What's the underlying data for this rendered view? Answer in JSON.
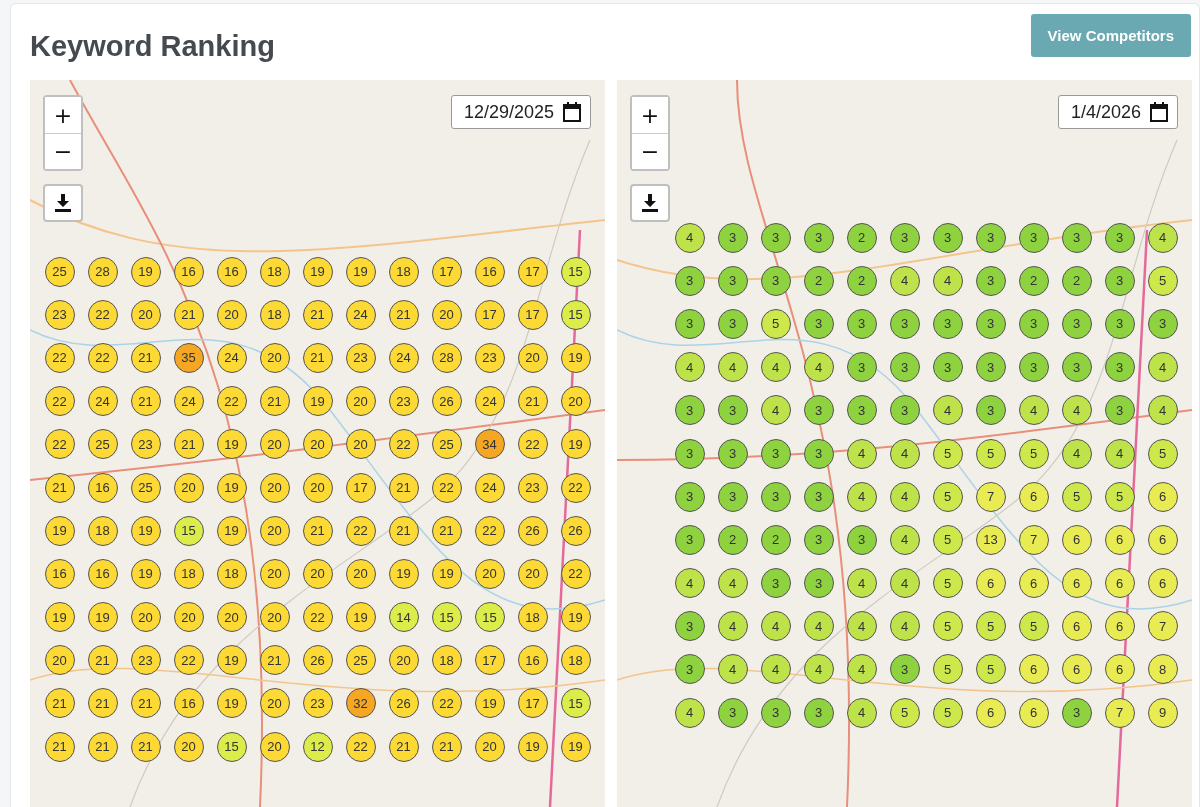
{
  "title": "Keyword Ranking",
  "action_button": "View Competitors",
  "maps": [
    {
      "zoom_in": "+",
      "zoom_out": "−",
      "date": "12/29/2025",
      "grid": [
        [
          {
            "rank": "25",
            "color": "#fcd934"
          },
          {
            "rank": "28",
            "color": "#fcd934"
          },
          {
            "rank": "19",
            "color": "#fcd934"
          },
          {
            "rank": "16",
            "color": "#fcd934"
          },
          {
            "rank": "16",
            "color": "#fcd934"
          },
          {
            "rank": "18",
            "color": "#fcd934"
          },
          {
            "rank": "19",
            "color": "#fcd934"
          },
          {
            "rank": "19",
            "color": "#fcd934"
          },
          {
            "rank": "18",
            "color": "#fcd934"
          },
          {
            "rank": "17",
            "color": "#fcd934"
          },
          {
            "rank": "16",
            "color": "#fcd934"
          },
          {
            "rank": "17",
            "color": "#fcd934"
          },
          {
            "rank": "15",
            "color": "#dcec4a"
          }
        ],
        [
          {
            "rank": "23",
            "color": "#fcd934"
          },
          {
            "rank": "22",
            "color": "#fcd934"
          },
          {
            "rank": "20",
            "color": "#fcd934"
          },
          {
            "rank": "21",
            "color": "#fcd934"
          },
          {
            "rank": "20",
            "color": "#fcd934"
          },
          {
            "rank": "18",
            "color": "#fcd934"
          },
          {
            "rank": "21",
            "color": "#fcd934"
          },
          {
            "rank": "24",
            "color": "#fcd934"
          },
          {
            "rank": "21",
            "color": "#fcd934"
          },
          {
            "rank": "20",
            "color": "#fcd934"
          },
          {
            "rank": "17",
            "color": "#fcd934"
          },
          {
            "rank": "17",
            "color": "#fcd934"
          },
          {
            "rank": "15",
            "color": "#dcec4a"
          }
        ],
        [
          {
            "rank": "22",
            "color": "#fcd934"
          },
          {
            "rank": "22",
            "color": "#fcd934"
          },
          {
            "rank": "21",
            "color": "#fcd934"
          },
          {
            "rank": "35",
            "color": "#f5a623"
          },
          {
            "rank": "24",
            "color": "#fcd934"
          },
          {
            "rank": "20",
            "color": "#fcd934"
          },
          {
            "rank": "21",
            "color": "#fcd934"
          },
          {
            "rank": "23",
            "color": "#fcd934"
          },
          {
            "rank": "24",
            "color": "#fcd934"
          },
          {
            "rank": "28",
            "color": "#fcd934"
          },
          {
            "rank": "23",
            "color": "#fcd934"
          },
          {
            "rank": "20",
            "color": "#fcd934"
          },
          {
            "rank": "19",
            "color": "#fcd934"
          }
        ],
        [
          {
            "rank": "22",
            "color": "#fcd934"
          },
          {
            "rank": "24",
            "color": "#fcd934"
          },
          {
            "rank": "21",
            "color": "#fcd934"
          },
          {
            "rank": "24",
            "color": "#fcd934"
          },
          {
            "rank": "22",
            "color": "#fcd934"
          },
          {
            "rank": "21",
            "color": "#fcd934"
          },
          {
            "rank": "19",
            "color": "#fcd934"
          },
          {
            "rank": "20",
            "color": "#fcd934"
          },
          {
            "rank": "23",
            "color": "#fcd934"
          },
          {
            "rank": "26",
            "color": "#fcd934"
          },
          {
            "rank": "24",
            "color": "#fcd934"
          },
          {
            "rank": "21",
            "color": "#fcd934"
          },
          {
            "rank": "20",
            "color": "#fcd934"
          }
        ],
        [
          {
            "rank": "22",
            "color": "#fcd934"
          },
          {
            "rank": "25",
            "color": "#fcd934"
          },
          {
            "rank": "23",
            "color": "#fcd934"
          },
          {
            "rank": "21",
            "color": "#fcd934"
          },
          {
            "rank": "19",
            "color": "#fcd934"
          },
          {
            "rank": "20",
            "color": "#fcd934"
          },
          {
            "rank": "20",
            "color": "#fcd934"
          },
          {
            "rank": "20",
            "color": "#fcd934"
          },
          {
            "rank": "22",
            "color": "#fcd934"
          },
          {
            "rank": "25",
            "color": "#fcd934"
          },
          {
            "rank": "34",
            "color": "#f5a623"
          },
          {
            "rank": "22",
            "color": "#fcd934"
          },
          {
            "rank": "19",
            "color": "#fcd934"
          }
        ],
        [
          {
            "rank": "21",
            "color": "#fcd934"
          },
          {
            "rank": "16",
            "color": "#fcd934"
          },
          {
            "rank": "25",
            "color": "#fcd934"
          },
          {
            "rank": "20",
            "color": "#fcd934"
          },
          {
            "rank": "19",
            "color": "#fcd934"
          },
          {
            "rank": "20",
            "color": "#fcd934"
          },
          {
            "rank": "20",
            "color": "#fcd934"
          },
          {
            "rank": "17",
            "color": "#fcd934"
          },
          {
            "rank": "21",
            "color": "#fcd934"
          },
          {
            "rank": "22",
            "color": "#fcd934"
          },
          {
            "rank": "24",
            "color": "#fcd934"
          },
          {
            "rank": "23",
            "color": "#fcd934"
          },
          {
            "rank": "22",
            "color": "#fcd934"
          }
        ],
        [
          {
            "rank": "19",
            "color": "#fcd934"
          },
          {
            "rank": "18",
            "color": "#fcd934"
          },
          {
            "rank": "19",
            "color": "#fcd934"
          },
          {
            "rank": "15",
            "color": "#dcec4a"
          },
          {
            "rank": "19",
            "color": "#fcd934"
          },
          {
            "rank": "20",
            "color": "#fcd934"
          },
          {
            "rank": "21",
            "color": "#fcd934"
          },
          {
            "rank": "22",
            "color": "#fcd934"
          },
          {
            "rank": "21",
            "color": "#fcd934"
          },
          {
            "rank": "21",
            "color": "#fcd934"
          },
          {
            "rank": "22",
            "color": "#fcd934"
          },
          {
            "rank": "26",
            "color": "#fcd934"
          },
          {
            "rank": "26",
            "color": "#fcd934"
          }
        ],
        [
          {
            "rank": "16",
            "color": "#fcd934"
          },
          {
            "rank": "16",
            "color": "#fcd934"
          },
          {
            "rank": "19",
            "color": "#fcd934"
          },
          {
            "rank": "18",
            "color": "#fcd934"
          },
          {
            "rank": "18",
            "color": "#fcd934"
          },
          {
            "rank": "20",
            "color": "#fcd934"
          },
          {
            "rank": "20",
            "color": "#fcd934"
          },
          {
            "rank": "20",
            "color": "#fcd934"
          },
          {
            "rank": "19",
            "color": "#fcd934"
          },
          {
            "rank": "19",
            "color": "#fcd934"
          },
          {
            "rank": "20",
            "color": "#fcd934"
          },
          {
            "rank": "20",
            "color": "#fcd934"
          },
          {
            "rank": "22",
            "color": "#fcd934"
          }
        ],
        [
          {
            "rank": "19",
            "color": "#fcd934"
          },
          {
            "rank": "19",
            "color": "#fcd934"
          },
          {
            "rank": "20",
            "color": "#fcd934"
          },
          {
            "rank": "20",
            "color": "#fcd934"
          },
          {
            "rank": "20",
            "color": "#fcd934"
          },
          {
            "rank": "20",
            "color": "#fcd934"
          },
          {
            "rank": "22",
            "color": "#fcd934"
          },
          {
            "rank": "19",
            "color": "#fcd934"
          },
          {
            "rank": "14",
            "color": "#dcec4a"
          },
          {
            "rank": "15",
            "color": "#dcec4a"
          },
          {
            "rank": "15",
            "color": "#dcec4a"
          },
          {
            "rank": "18",
            "color": "#fcd934"
          },
          {
            "rank": "19",
            "color": "#fcd934"
          }
        ],
        [
          {
            "rank": "20",
            "color": "#fcd934"
          },
          {
            "rank": "21",
            "color": "#fcd934"
          },
          {
            "rank": "23",
            "color": "#fcd934"
          },
          {
            "rank": "22",
            "color": "#fcd934"
          },
          {
            "rank": "19",
            "color": "#fcd934"
          },
          {
            "rank": "21",
            "color": "#fcd934"
          },
          {
            "rank": "26",
            "color": "#fcd934"
          },
          {
            "rank": "25",
            "color": "#fcd934"
          },
          {
            "rank": "20",
            "color": "#fcd934"
          },
          {
            "rank": "18",
            "color": "#fcd934"
          },
          {
            "rank": "17",
            "color": "#fcd934"
          },
          {
            "rank": "16",
            "color": "#fcd934"
          },
          {
            "rank": "18",
            "color": "#fcd934"
          }
        ],
        [
          {
            "rank": "21",
            "color": "#fcd934"
          },
          {
            "rank": "21",
            "color": "#fcd934"
          },
          {
            "rank": "21",
            "color": "#fcd934"
          },
          {
            "rank": "16",
            "color": "#fcd934"
          },
          {
            "rank": "19",
            "color": "#fcd934"
          },
          {
            "rank": "20",
            "color": "#fcd934"
          },
          {
            "rank": "23",
            "color": "#fcd934"
          },
          {
            "rank": "32",
            "color": "#f5a623"
          },
          {
            "rank": "26",
            "color": "#fcd934"
          },
          {
            "rank": "22",
            "color": "#fcd934"
          },
          {
            "rank": "19",
            "color": "#fcd934"
          },
          {
            "rank": "17",
            "color": "#fcd934"
          },
          {
            "rank": "15",
            "color": "#dcec4a"
          }
        ],
        [
          {
            "rank": "21",
            "color": "#fcd934"
          },
          {
            "rank": "21",
            "color": "#fcd934"
          },
          {
            "rank": "21",
            "color": "#fcd934"
          },
          {
            "rank": "20",
            "color": "#fcd934"
          },
          {
            "rank": "15",
            "color": "#dcec4a"
          },
          {
            "rank": "20",
            "color": "#fcd934"
          },
          {
            "rank": "12",
            "color": "#dcec4a"
          },
          {
            "rank": "22",
            "color": "#fcd934"
          },
          {
            "rank": "21",
            "color": "#fcd934"
          },
          {
            "rank": "21",
            "color": "#fcd934"
          },
          {
            "rank": "20",
            "color": "#fcd934"
          },
          {
            "rank": "19",
            "color": "#fcd934"
          },
          {
            "rank": "19",
            "color": "#fcd934"
          }
        ]
      ]
    },
    {
      "zoom_in": "+",
      "zoom_out": "−",
      "date": "1/4/2026",
      "grid": [
        [
          {
            "rank": "4",
            "color": "#bde24a"
          },
          {
            "rank": "3",
            "color": "#8fd23f"
          },
          {
            "rank": "3",
            "color": "#8fd23f"
          },
          {
            "rank": "3",
            "color": "#8fd23f"
          },
          {
            "rank": "2",
            "color": "#8fd23f"
          },
          {
            "rank": "3",
            "color": "#8fd23f"
          },
          {
            "rank": "3",
            "color": "#8fd23f"
          },
          {
            "rank": "3",
            "color": "#8fd23f"
          },
          {
            "rank": "3",
            "color": "#8fd23f"
          },
          {
            "rank": "3",
            "color": "#8fd23f"
          },
          {
            "rank": "3",
            "color": "#8fd23f"
          },
          {
            "rank": "4",
            "color": "#bde24a"
          }
        ],
        [
          {
            "rank": "3",
            "color": "#8fd23f"
          },
          {
            "rank": "3",
            "color": "#8fd23f"
          },
          {
            "rank": "3",
            "color": "#8fd23f"
          },
          {
            "rank": "2",
            "color": "#8fd23f"
          },
          {
            "rank": "2",
            "color": "#8fd23f"
          },
          {
            "rank": "4",
            "color": "#bde24a"
          },
          {
            "rank": "4",
            "color": "#bde24a"
          },
          {
            "rank": "3",
            "color": "#8fd23f"
          },
          {
            "rank": "2",
            "color": "#8fd23f"
          },
          {
            "rank": "2",
            "color": "#8fd23f"
          },
          {
            "rank": "3",
            "color": "#8fd23f"
          },
          {
            "rank": "5",
            "color": "#cde84a"
          }
        ],
        [
          {
            "rank": "3",
            "color": "#8fd23f"
          },
          {
            "rank": "3",
            "color": "#8fd23f"
          },
          {
            "rank": "5",
            "color": "#cde84a"
          },
          {
            "rank": "3",
            "color": "#8fd23f"
          },
          {
            "rank": "3",
            "color": "#8fd23f"
          },
          {
            "rank": "3",
            "color": "#8fd23f"
          },
          {
            "rank": "3",
            "color": "#8fd23f"
          },
          {
            "rank": "3",
            "color": "#8fd23f"
          },
          {
            "rank": "3",
            "color": "#8fd23f"
          },
          {
            "rank": "3",
            "color": "#8fd23f"
          },
          {
            "rank": "3",
            "color": "#8fd23f"
          },
          {
            "rank": "3",
            "color": "#8fd23f"
          }
        ],
        [
          {
            "rank": "4",
            "color": "#bde24a"
          },
          {
            "rank": "4",
            "color": "#bde24a"
          },
          {
            "rank": "4",
            "color": "#bde24a"
          },
          {
            "rank": "4",
            "color": "#bde24a"
          },
          {
            "rank": "3",
            "color": "#8fd23f"
          },
          {
            "rank": "3",
            "color": "#8fd23f"
          },
          {
            "rank": "3",
            "color": "#8fd23f"
          },
          {
            "rank": "3",
            "color": "#8fd23f"
          },
          {
            "rank": "3",
            "color": "#8fd23f"
          },
          {
            "rank": "3",
            "color": "#8fd23f"
          },
          {
            "rank": "3",
            "color": "#8fd23f"
          },
          {
            "rank": "4",
            "color": "#bde24a"
          }
        ],
        [
          {
            "rank": "3",
            "color": "#8fd23f"
          },
          {
            "rank": "3",
            "color": "#8fd23f"
          },
          {
            "rank": "4",
            "color": "#bde24a"
          },
          {
            "rank": "3",
            "color": "#8fd23f"
          },
          {
            "rank": "3",
            "color": "#8fd23f"
          },
          {
            "rank": "3",
            "color": "#8fd23f"
          },
          {
            "rank": "4",
            "color": "#bde24a"
          },
          {
            "rank": "3",
            "color": "#8fd23f"
          },
          {
            "rank": "4",
            "color": "#bde24a"
          },
          {
            "rank": "4",
            "color": "#bde24a"
          },
          {
            "rank": "3",
            "color": "#8fd23f"
          },
          {
            "rank": "4",
            "color": "#bde24a"
          }
        ],
        [
          {
            "rank": "3",
            "color": "#8fd23f"
          },
          {
            "rank": "3",
            "color": "#8fd23f"
          },
          {
            "rank": "3",
            "color": "#8fd23f"
          },
          {
            "rank": "3",
            "color": "#8fd23f"
          },
          {
            "rank": "4",
            "color": "#bde24a"
          },
          {
            "rank": "4",
            "color": "#bde24a"
          },
          {
            "rank": "5",
            "color": "#cde84a"
          },
          {
            "rank": "5",
            "color": "#cde84a"
          },
          {
            "rank": "5",
            "color": "#cde84a"
          },
          {
            "rank": "4",
            "color": "#bde24a"
          },
          {
            "rank": "4",
            "color": "#bde24a"
          },
          {
            "rank": "5",
            "color": "#cde84a"
          }
        ],
        [
          {
            "rank": "3",
            "color": "#8fd23f"
          },
          {
            "rank": "3",
            "color": "#8fd23f"
          },
          {
            "rank": "3",
            "color": "#8fd23f"
          },
          {
            "rank": "3",
            "color": "#8fd23f"
          },
          {
            "rank": "4",
            "color": "#bde24a"
          },
          {
            "rank": "4",
            "color": "#bde24a"
          },
          {
            "rank": "5",
            "color": "#cde84a"
          },
          {
            "rank": "7",
            "color": "#e8ec52"
          },
          {
            "rank": "6",
            "color": "#e8ec52"
          },
          {
            "rank": "5",
            "color": "#cde84a"
          },
          {
            "rank": "5",
            "color": "#cde84a"
          },
          {
            "rank": "6",
            "color": "#e8ec52"
          }
        ],
        [
          {
            "rank": "3",
            "color": "#8fd23f"
          },
          {
            "rank": "2",
            "color": "#8fd23f"
          },
          {
            "rank": "2",
            "color": "#8fd23f"
          },
          {
            "rank": "3",
            "color": "#8fd23f"
          },
          {
            "rank": "3",
            "color": "#8fd23f"
          },
          {
            "rank": "4",
            "color": "#bde24a"
          },
          {
            "rank": "5",
            "color": "#cde84a"
          },
          {
            "rank": "13",
            "color": "#e8ec52"
          },
          {
            "rank": "7",
            "color": "#e8ec52"
          },
          {
            "rank": "6",
            "color": "#e8ec52"
          },
          {
            "rank": "6",
            "color": "#e8ec52"
          },
          {
            "rank": "6",
            "color": "#e8ec52"
          }
        ],
        [
          {
            "rank": "4",
            "color": "#bde24a"
          },
          {
            "rank": "4",
            "color": "#bde24a"
          },
          {
            "rank": "3",
            "color": "#8fd23f"
          },
          {
            "rank": "3",
            "color": "#8fd23f"
          },
          {
            "rank": "4",
            "color": "#bde24a"
          },
          {
            "rank": "4",
            "color": "#bde24a"
          },
          {
            "rank": "5",
            "color": "#cde84a"
          },
          {
            "rank": "6",
            "color": "#e8ec52"
          },
          {
            "rank": "6",
            "color": "#e8ec52"
          },
          {
            "rank": "6",
            "color": "#e8ec52"
          },
          {
            "rank": "6",
            "color": "#e8ec52"
          },
          {
            "rank": "6",
            "color": "#e8ec52"
          }
        ],
        [
          {
            "rank": "3",
            "color": "#8fd23f"
          },
          {
            "rank": "4",
            "color": "#bde24a"
          },
          {
            "rank": "4",
            "color": "#bde24a"
          },
          {
            "rank": "4",
            "color": "#bde24a"
          },
          {
            "rank": "4",
            "color": "#bde24a"
          },
          {
            "rank": "4",
            "color": "#bde24a"
          },
          {
            "rank": "5",
            "color": "#cde84a"
          },
          {
            "rank": "5",
            "color": "#cde84a"
          },
          {
            "rank": "5",
            "color": "#cde84a"
          },
          {
            "rank": "6",
            "color": "#e8ec52"
          },
          {
            "rank": "6",
            "color": "#e8ec52"
          },
          {
            "rank": "7",
            "color": "#e8ec52"
          }
        ],
        [
          {
            "rank": "3",
            "color": "#8fd23f"
          },
          {
            "rank": "4",
            "color": "#bde24a"
          },
          {
            "rank": "4",
            "color": "#bde24a"
          },
          {
            "rank": "4",
            "color": "#bde24a"
          },
          {
            "rank": "4",
            "color": "#bde24a"
          },
          {
            "rank": "3",
            "color": "#8fd23f"
          },
          {
            "rank": "5",
            "color": "#cde84a"
          },
          {
            "rank": "5",
            "color": "#cde84a"
          },
          {
            "rank": "6",
            "color": "#e8ec52"
          },
          {
            "rank": "6",
            "color": "#e8ec52"
          },
          {
            "rank": "6",
            "color": "#e8ec52"
          },
          {
            "rank": "8",
            "color": "#e8ec52"
          }
        ],
        [
          {
            "rank": "4",
            "color": "#bde24a"
          },
          {
            "rank": "3",
            "color": "#8fd23f"
          },
          {
            "rank": "3",
            "color": "#8fd23f"
          },
          {
            "rank": "3",
            "color": "#8fd23f"
          },
          {
            "rank": "4",
            "color": "#bde24a"
          },
          {
            "rank": "5",
            "color": "#cde84a"
          },
          {
            "rank": "5",
            "color": "#cde84a"
          },
          {
            "rank": "6",
            "color": "#e8ec52"
          },
          {
            "rank": "6",
            "color": "#e8ec52"
          },
          {
            "rank": "3",
            "color": "#8fd23f"
          },
          {
            "rank": "7",
            "color": "#e8ec52"
          },
          {
            "rank": "9",
            "color": "#e8ec52"
          }
        ]
      ]
    }
  ]
}
